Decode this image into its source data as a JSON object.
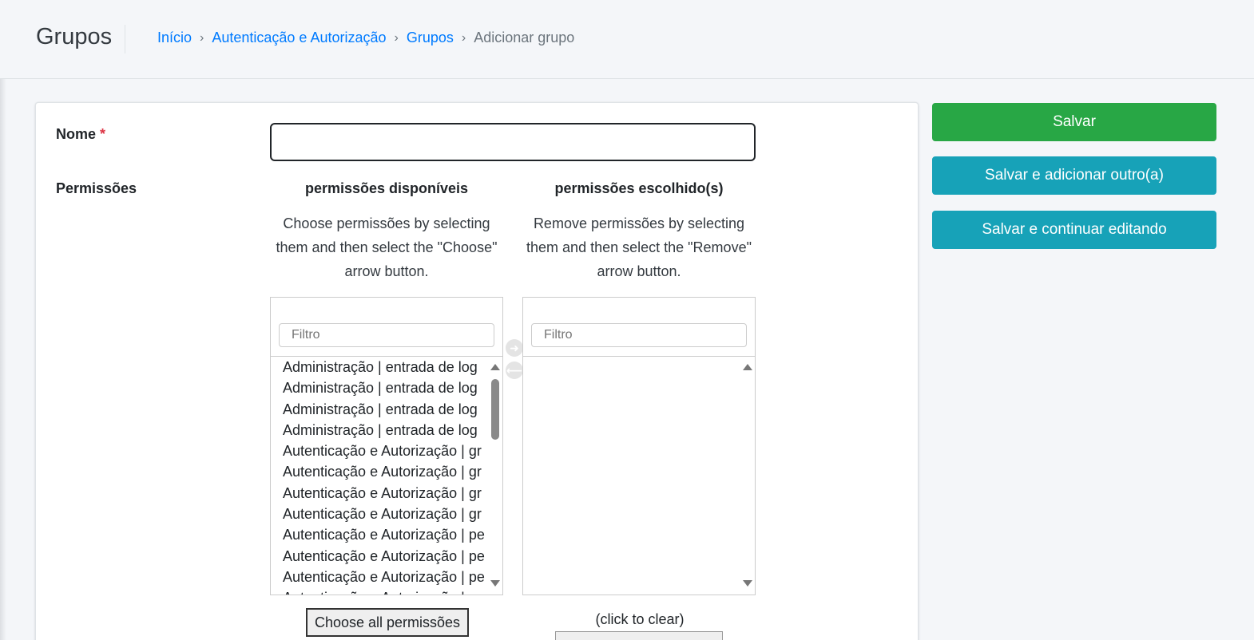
{
  "header": {
    "title": "Grupos",
    "breadcrumb": [
      {
        "label": "Início"
      },
      {
        "label": "Autenticação e Autorização"
      },
      {
        "label": "Grupos"
      }
    ],
    "breadcrumb_current": "Adicionar grupo",
    "separator": "›"
  },
  "form": {
    "name_label": "Nome",
    "required_marker": "*",
    "name_value": "",
    "permissions_label": "Permissões",
    "available": {
      "title": "permissões disponíveis",
      "help": "Choose permissões by selecting them and then select the \"Choose\" arrow button.",
      "filter_placeholder": "Filtro",
      "items": [
        "Administração | entrada de log",
        "Administração | entrada de log",
        "Administração | entrada de log",
        "Administração | entrada de log",
        "Autenticação e Autorização | gr",
        "Autenticação e Autorização | gr",
        "Autenticação e Autorização | gr",
        "Autenticação e Autorização | gr",
        "Autenticação e Autorização | pe",
        "Autenticação e Autorização | pe",
        "Autenticação e Autorização | pe",
        "Autenticação e Autorização | pe"
      ],
      "choose_all_label": "Choose all permissões"
    },
    "chosen": {
      "title": "permissões escolhido(s)",
      "help": "Remove permissões by selecting them and then select the \"Remove\" arrow button.",
      "filter_placeholder": "Filtro",
      "items": [],
      "clear_hint": "(click to clear)"
    }
  },
  "actions": {
    "save": "Salvar",
    "save_add_another": "Salvar e adicionar outro(a)",
    "save_continue": "Salvar e continuar editando"
  },
  "colors": {
    "link": "#007bff",
    "save_button": "#28a745",
    "secondary_button": "#17a2b8",
    "required": "#dc3545"
  },
  "icons": {
    "choose": "arrow-right-circle-icon",
    "remove": "arrow-left-circle-icon"
  }
}
